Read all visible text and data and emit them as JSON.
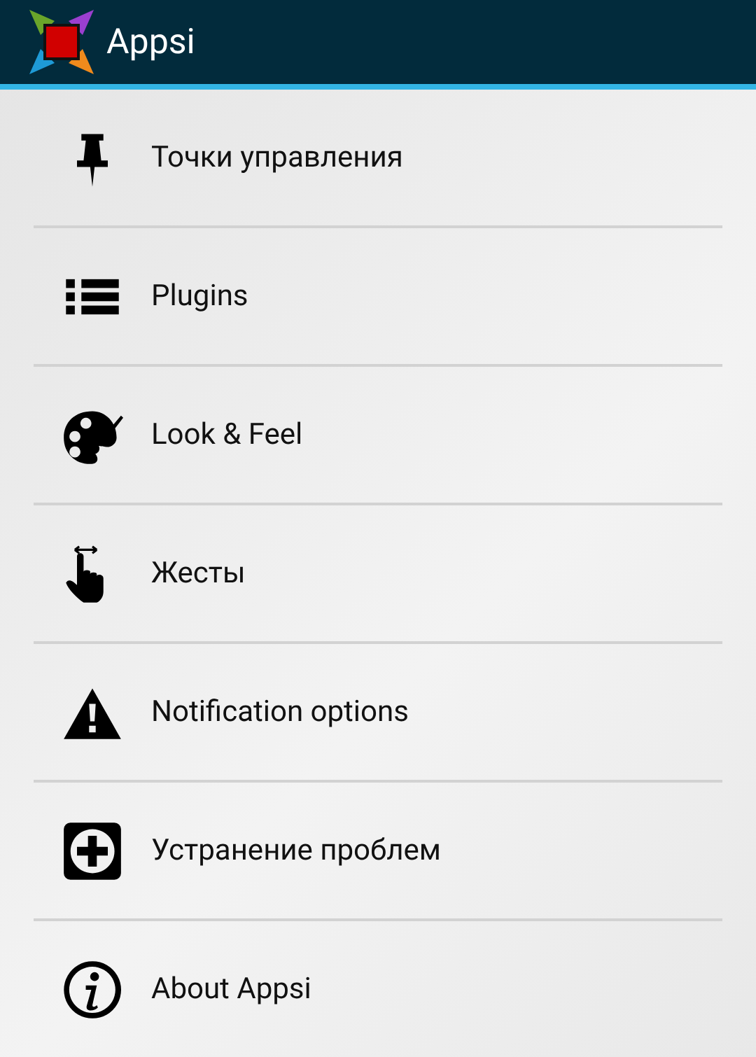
{
  "action_bar": {
    "title": "Appsi"
  },
  "items": [
    {
      "label": "Точки управления"
    },
    {
      "label": "Plugins"
    },
    {
      "label": "Look & Feel"
    },
    {
      "label": "Жесты"
    },
    {
      "label": "Notification options"
    },
    {
      "label": "Устранение проблем"
    },
    {
      "label": "About Appsi"
    }
  ]
}
